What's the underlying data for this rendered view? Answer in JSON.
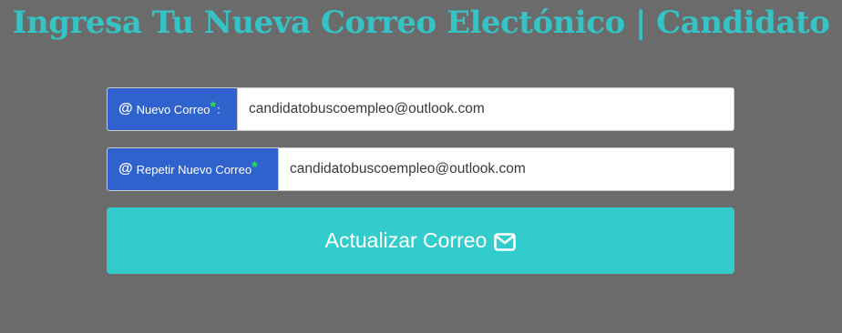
{
  "page": {
    "title": "Ingresa Tu Nueva Correo Electónico | Candidato"
  },
  "form": {
    "new_email": {
      "icon": "at-icon",
      "label": "Nuevo Correo",
      "required_mark": "*",
      "suffix": ":",
      "value": "candidatobuscoempleo@outlook.com"
    },
    "repeat_email": {
      "icon": "at-icon",
      "label": "Repetir Nuevo Correo",
      "required_mark": "*",
      "value": "candidatobuscoempleo@outlook.com"
    },
    "submit": {
      "label": "Actualizar Correo",
      "icon": "envelope-icon"
    }
  },
  "colors": {
    "background": "#6b6b6b",
    "title": "#35c3c5",
    "addon": "#2f62cc",
    "required": "#22e84a",
    "button": "#33cccc"
  }
}
